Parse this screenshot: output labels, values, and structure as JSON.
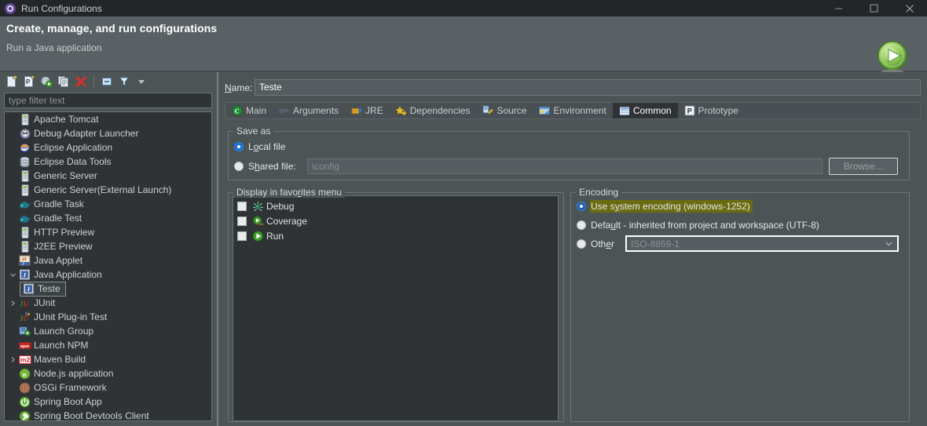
{
  "window": {
    "title": "Run Configurations",
    "icon": "run-configurations-icon",
    "controls": {
      "minimize": "—",
      "maximize": "☐",
      "close": "✕"
    }
  },
  "header": {
    "title": "Create, manage, and run configurations",
    "subtitle": "Run a Java application",
    "icon": "run-play-icon"
  },
  "left_panel": {
    "toolbar": [
      {
        "name": "new-launch-configuration-icon",
        "tooltip": "New launch configuration"
      },
      {
        "name": "new-prototype-icon",
        "tooltip": "New prototype"
      },
      {
        "name": "export-launch-configuration-icon",
        "tooltip": "Export"
      },
      {
        "name": "duplicate-icon",
        "tooltip": "Duplicate"
      },
      {
        "name": "delete-icon",
        "tooltip": "Delete"
      },
      {
        "name": "collapse-all-icon",
        "tooltip": "Collapse All"
      },
      {
        "name": "filter-icon",
        "tooltip": "Filter launch configurations"
      },
      {
        "name": "dropdown-arrow-icon",
        "tooltip": "View menu"
      }
    ],
    "filter_placeholder": "type filter text",
    "tree": [
      {
        "label": "Apache Tomcat",
        "icon": "server-icon",
        "arrow": "none",
        "indent": 0,
        "selected": false
      },
      {
        "label": "Debug Adapter Launcher",
        "icon": "debug-adapter-icon",
        "arrow": "none",
        "indent": 0,
        "selected": false
      },
      {
        "label": "Eclipse Application",
        "icon": "eclipse-icon",
        "arrow": "none",
        "indent": 0,
        "selected": false
      },
      {
        "label": "Eclipse Data Tools",
        "icon": "database-icon",
        "arrow": "none",
        "indent": 0,
        "selected": false
      },
      {
        "label": "Generic Server",
        "icon": "server-icon",
        "arrow": "none",
        "indent": 0,
        "selected": false
      },
      {
        "label": "Generic Server(External Launch)",
        "icon": "server-icon",
        "arrow": "none",
        "indent": 0,
        "selected": false
      },
      {
        "label": "Gradle Task",
        "icon": "gradle-icon",
        "arrow": "none",
        "indent": 0,
        "selected": false
      },
      {
        "label": "Gradle Test",
        "icon": "gradle-icon",
        "arrow": "none",
        "indent": 0,
        "selected": false
      },
      {
        "label": "HTTP Preview",
        "icon": "server-icon",
        "arrow": "none",
        "indent": 0,
        "selected": false
      },
      {
        "label": "J2EE Preview",
        "icon": "server-icon",
        "arrow": "none",
        "indent": 0,
        "selected": false
      },
      {
        "label": "Java Applet",
        "icon": "java-applet-icon",
        "arrow": "none",
        "indent": 0,
        "selected": false
      },
      {
        "label": "Java Application",
        "icon": "java-application-icon",
        "arrow": "expanded",
        "indent": 0,
        "selected": false
      },
      {
        "label": "Teste",
        "icon": "java-application-icon",
        "arrow": "none",
        "indent": 1,
        "selected": true
      },
      {
        "label": "JUnit",
        "icon": "junit-icon",
        "arrow": "collapsed",
        "indent": 0,
        "selected": false
      },
      {
        "label": "JUnit Plug-in Test",
        "icon": "junit-plugin-icon",
        "arrow": "none",
        "indent": 0,
        "selected": false
      },
      {
        "label": "Launch Group",
        "icon": "launch-group-icon",
        "arrow": "none",
        "indent": 0,
        "selected": false
      },
      {
        "label": "Launch NPM",
        "icon": "npm-icon",
        "arrow": "none",
        "indent": 0,
        "selected": false
      },
      {
        "label": "Maven Build",
        "icon": "maven-icon",
        "arrow": "collapsed",
        "indent": 0,
        "selected": false
      },
      {
        "label": "Node.js application",
        "icon": "node-icon",
        "arrow": "none",
        "indent": 0,
        "selected": false
      },
      {
        "label": "OSGi Framework",
        "icon": "osgi-icon",
        "arrow": "none",
        "indent": 0,
        "selected": false
      },
      {
        "label": "Spring Boot App",
        "icon": "spring-boot-icon",
        "arrow": "none",
        "indent": 0,
        "selected": false
      },
      {
        "label": "Spring Boot Devtools Client",
        "icon": "spring-boot-devtools-icon",
        "arrow": "none",
        "indent": 0,
        "selected": false
      }
    ]
  },
  "right_panel": {
    "name_label": "Name:",
    "name_value": "Teste",
    "tabs": [
      {
        "label": "Main",
        "icon": "main-tab-icon",
        "active": false
      },
      {
        "label": "Arguments",
        "icon": "arguments-tab-icon",
        "active": false
      },
      {
        "label": "JRE",
        "icon": "jre-tab-icon",
        "active": false
      },
      {
        "label": "Dependencies",
        "icon": "dependencies-tab-icon",
        "active": false
      },
      {
        "label": "Source",
        "icon": "source-tab-icon",
        "active": false
      },
      {
        "label": "Environment",
        "icon": "environment-tab-icon",
        "active": false
      },
      {
        "label": "Common",
        "icon": "common-tab-icon",
        "active": true
      },
      {
        "label": "Prototype",
        "icon": "prototype-tab-icon",
        "active": false
      }
    ],
    "save_as": {
      "legend": "Save as",
      "local_file": {
        "label": "Local file",
        "selected": true
      },
      "shared_file": {
        "label": "Shared file:",
        "selected": false
      },
      "shared_path_placeholder": "\\config",
      "browse_label": "Browse...",
      "browse_enabled": false
    },
    "favorites": {
      "legend": "Display in favorites menu",
      "items": [
        {
          "label": "Debug",
          "icon": "debug-bug-icon",
          "checked": false
        },
        {
          "label": "Coverage",
          "icon": "coverage-icon",
          "checked": false
        },
        {
          "label": "Run",
          "icon": "run-play-icon",
          "checked": false
        }
      ]
    },
    "encoding": {
      "legend": "Encoding",
      "system": {
        "label": "Use system encoding (windows-1252)",
        "selected": true,
        "highlighted": true
      },
      "default": {
        "label": "Default - inherited from project and workspace (UTF-8)",
        "selected": false
      },
      "other": {
        "label": "Other",
        "selected": false,
        "value_placeholder": "ISO-8859-1",
        "enabled": false
      }
    }
  },
  "colors": {
    "titlebar_bg": "#232629",
    "header_bg": "#5a6164",
    "panel_bg": "#4d5456",
    "field_bg": "#2f3336",
    "accent_blue": "#1b6fd0",
    "highlight_olive": "#6b6b10",
    "text": "#d4d4d4"
  }
}
